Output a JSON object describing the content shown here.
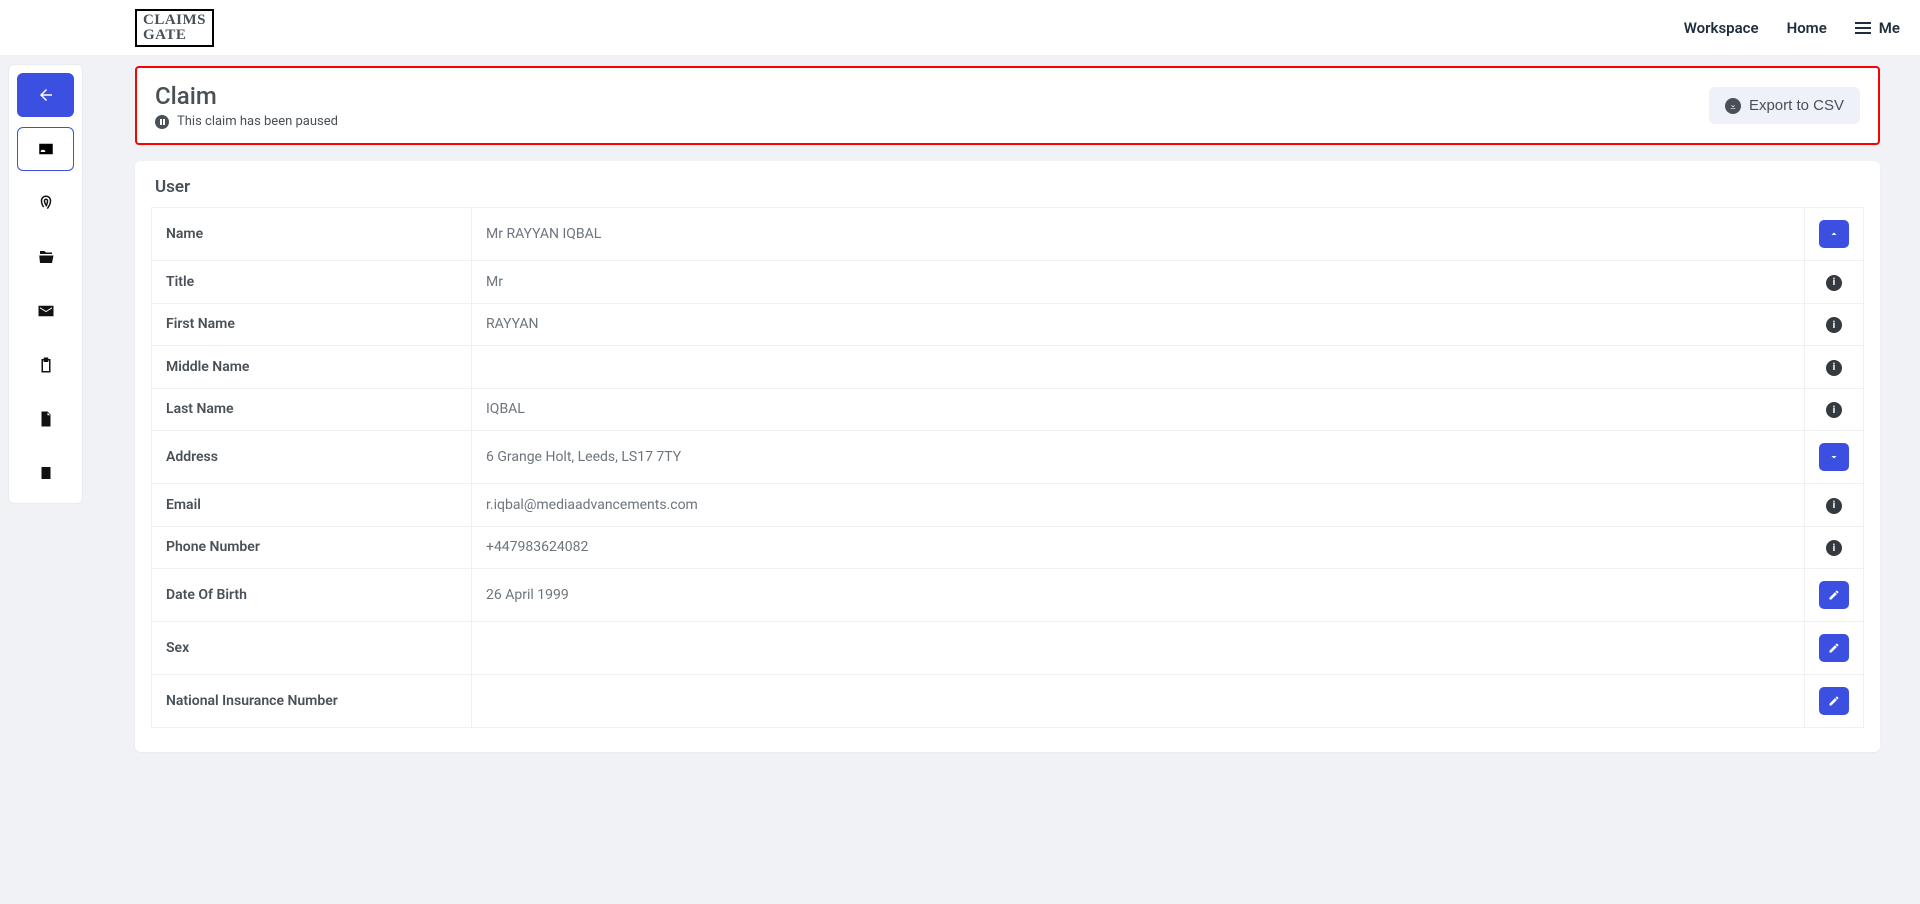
{
  "brand": {
    "line1": "CLAIMS",
    "line2": "GATE"
  },
  "nav": {
    "workspace": "Workspace",
    "home": "Home",
    "me": "Me"
  },
  "header": {
    "title": "Claim",
    "status": "This claim has been paused",
    "export_label": "Export to CSV"
  },
  "user_section_title": "User",
  "fields": {
    "name": {
      "label": "Name",
      "value": "Mr RAYYAN IQBAL",
      "action": "collapse"
    },
    "title": {
      "label": "Title",
      "value": "Mr",
      "action": "info"
    },
    "first_name": {
      "label": "First Name",
      "value": "RAYYAN",
      "action": "info"
    },
    "middle_name": {
      "label": "Middle Name",
      "value": "",
      "action": "info"
    },
    "last_name": {
      "label": "Last Name",
      "value": "IQBAL",
      "action": "info"
    },
    "address": {
      "label": "Address",
      "value": "6 Grange Holt, Leeds, LS17 7TY",
      "action": "expand"
    },
    "email": {
      "label": "Email",
      "value": "r.iqbal@mediaadvancements.com",
      "action": "info"
    },
    "phone": {
      "label": "Phone Number",
      "value": "+447983624082",
      "action": "info"
    },
    "dob": {
      "label": "Date Of Birth",
      "value": "26 April 1999",
      "action": "edit"
    },
    "sex": {
      "label": "Sex",
      "value": "",
      "action": "edit"
    },
    "nino": {
      "label": "National Insurance Number",
      "value": "",
      "action": "edit"
    }
  }
}
